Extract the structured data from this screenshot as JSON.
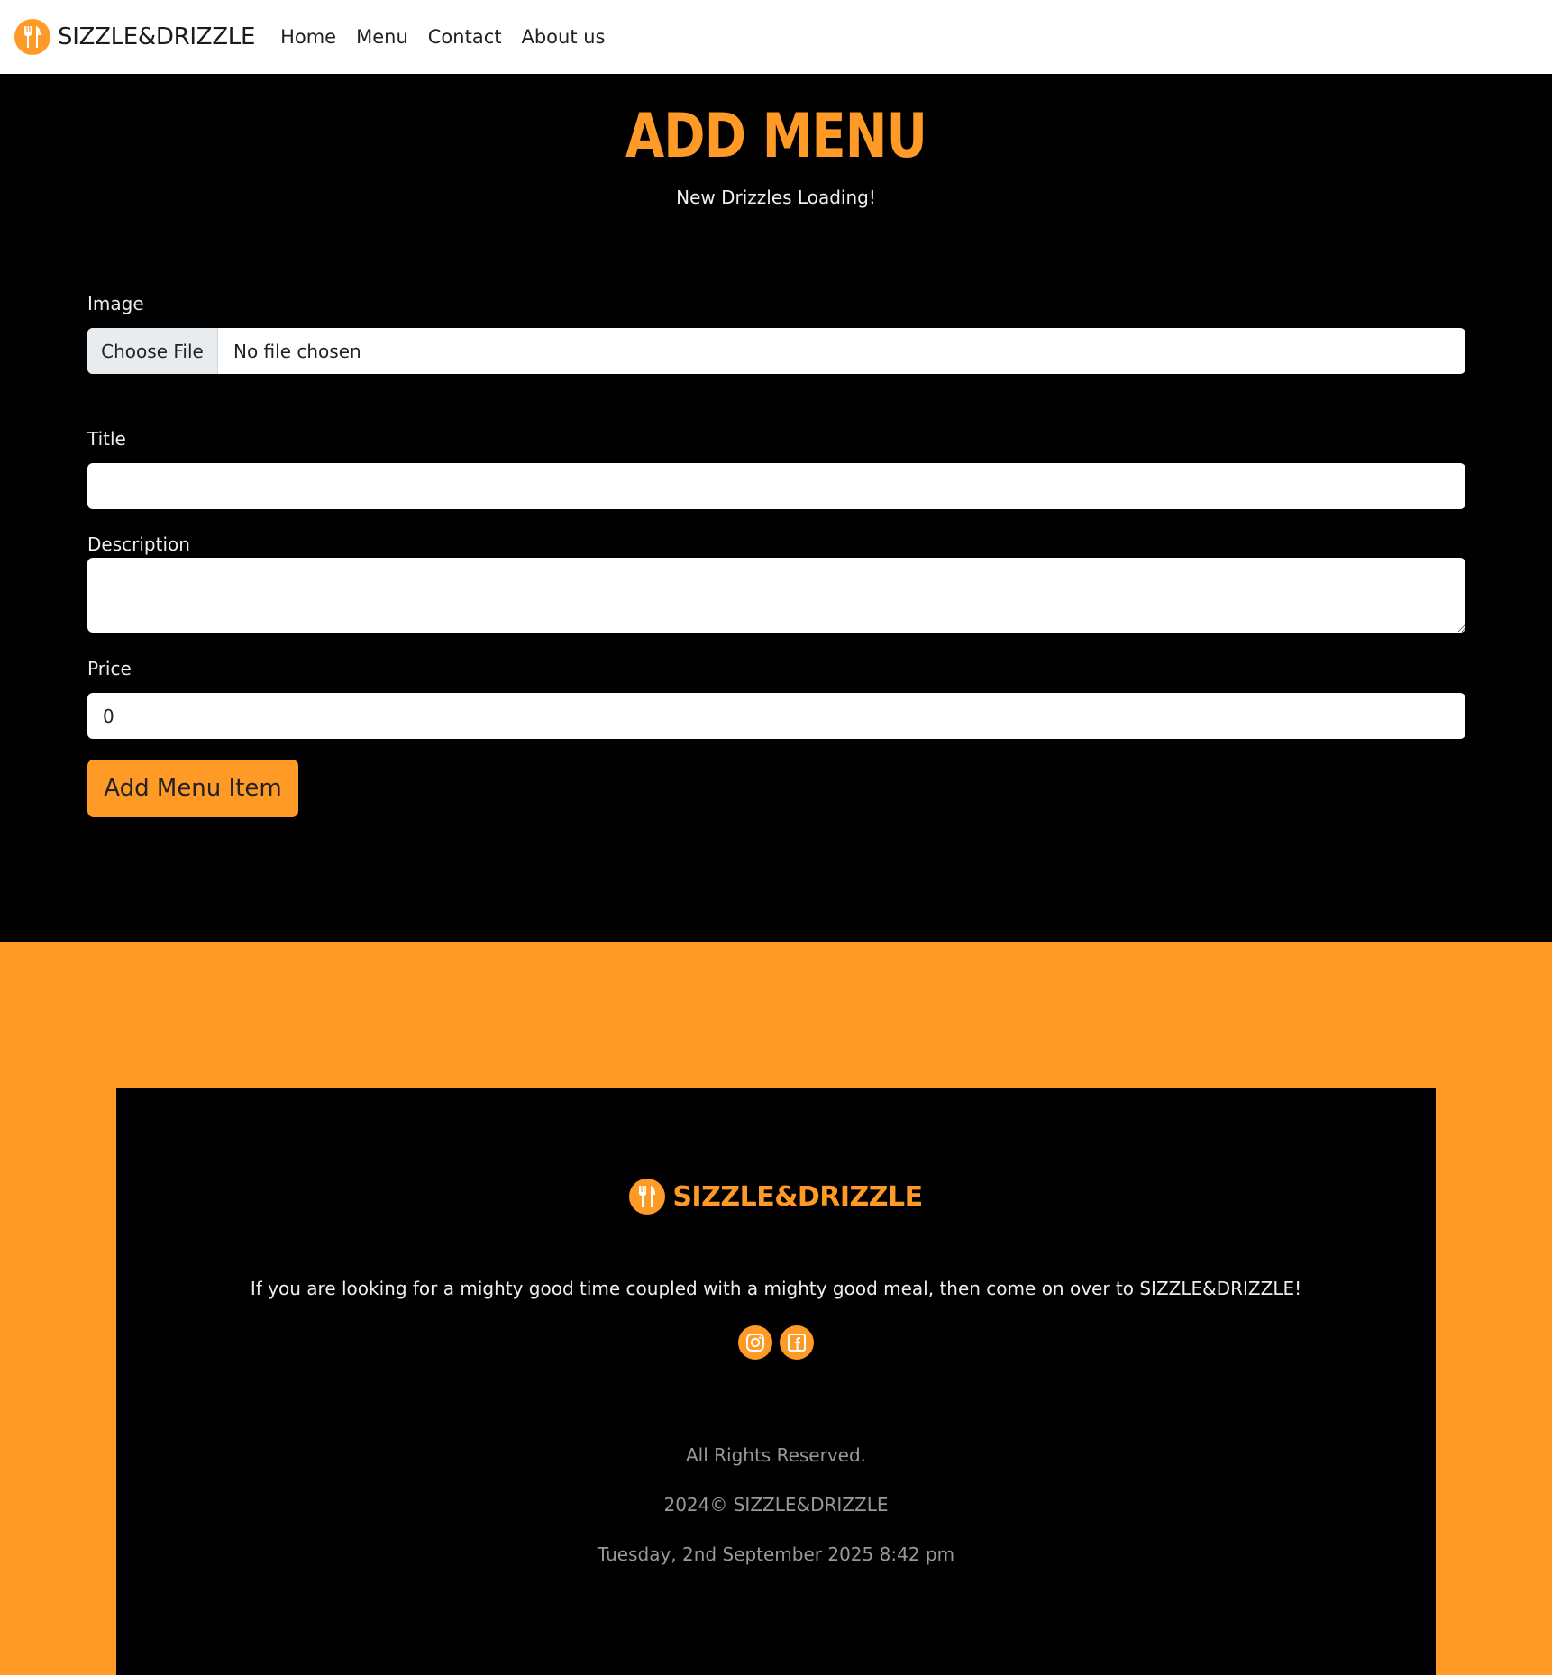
{
  "navbar": {
    "brand": "SIZZLE&DRIZZLE",
    "links": [
      "Home",
      "Menu",
      "Contact",
      "About us"
    ]
  },
  "page": {
    "title": "ADD MENU",
    "subtitle": "New Drizzles Loading!"
  },
  "form": {
    "image_label": "Image",
    "choose_file_label": "Choose File",
    "file_status": "No file chosen",
    "title_label": "Title",
    "title_value": "",
    "description_label": "Description",
    "description_value": "",
    "price_label": "Price",
    "price_value": "0",
    "submit_label": "Add Menu Item"
  },
  "footer": {
    "brand": "SIZZLE&DRIZZLE",
    "tagline": "If you are looking for a mighty good time coupled with a mighty good meal, then come on over to SIZZLE&DRIZZLE!",
    "socials": [
      "instagram-icon",
      "facebook-icon"
    ],
    "rights": "All Rights Reserved.",
    "copyright": "2024© SIZZLE&DRIZZLE",
    "datetime": "Tuesday, 2nd September 2025 8:42 pm"
  },
  "colors": {
    "accent": "#ff9a26",
    "background": "#000000",
    "navbar": "#ffffff"
  }
}
